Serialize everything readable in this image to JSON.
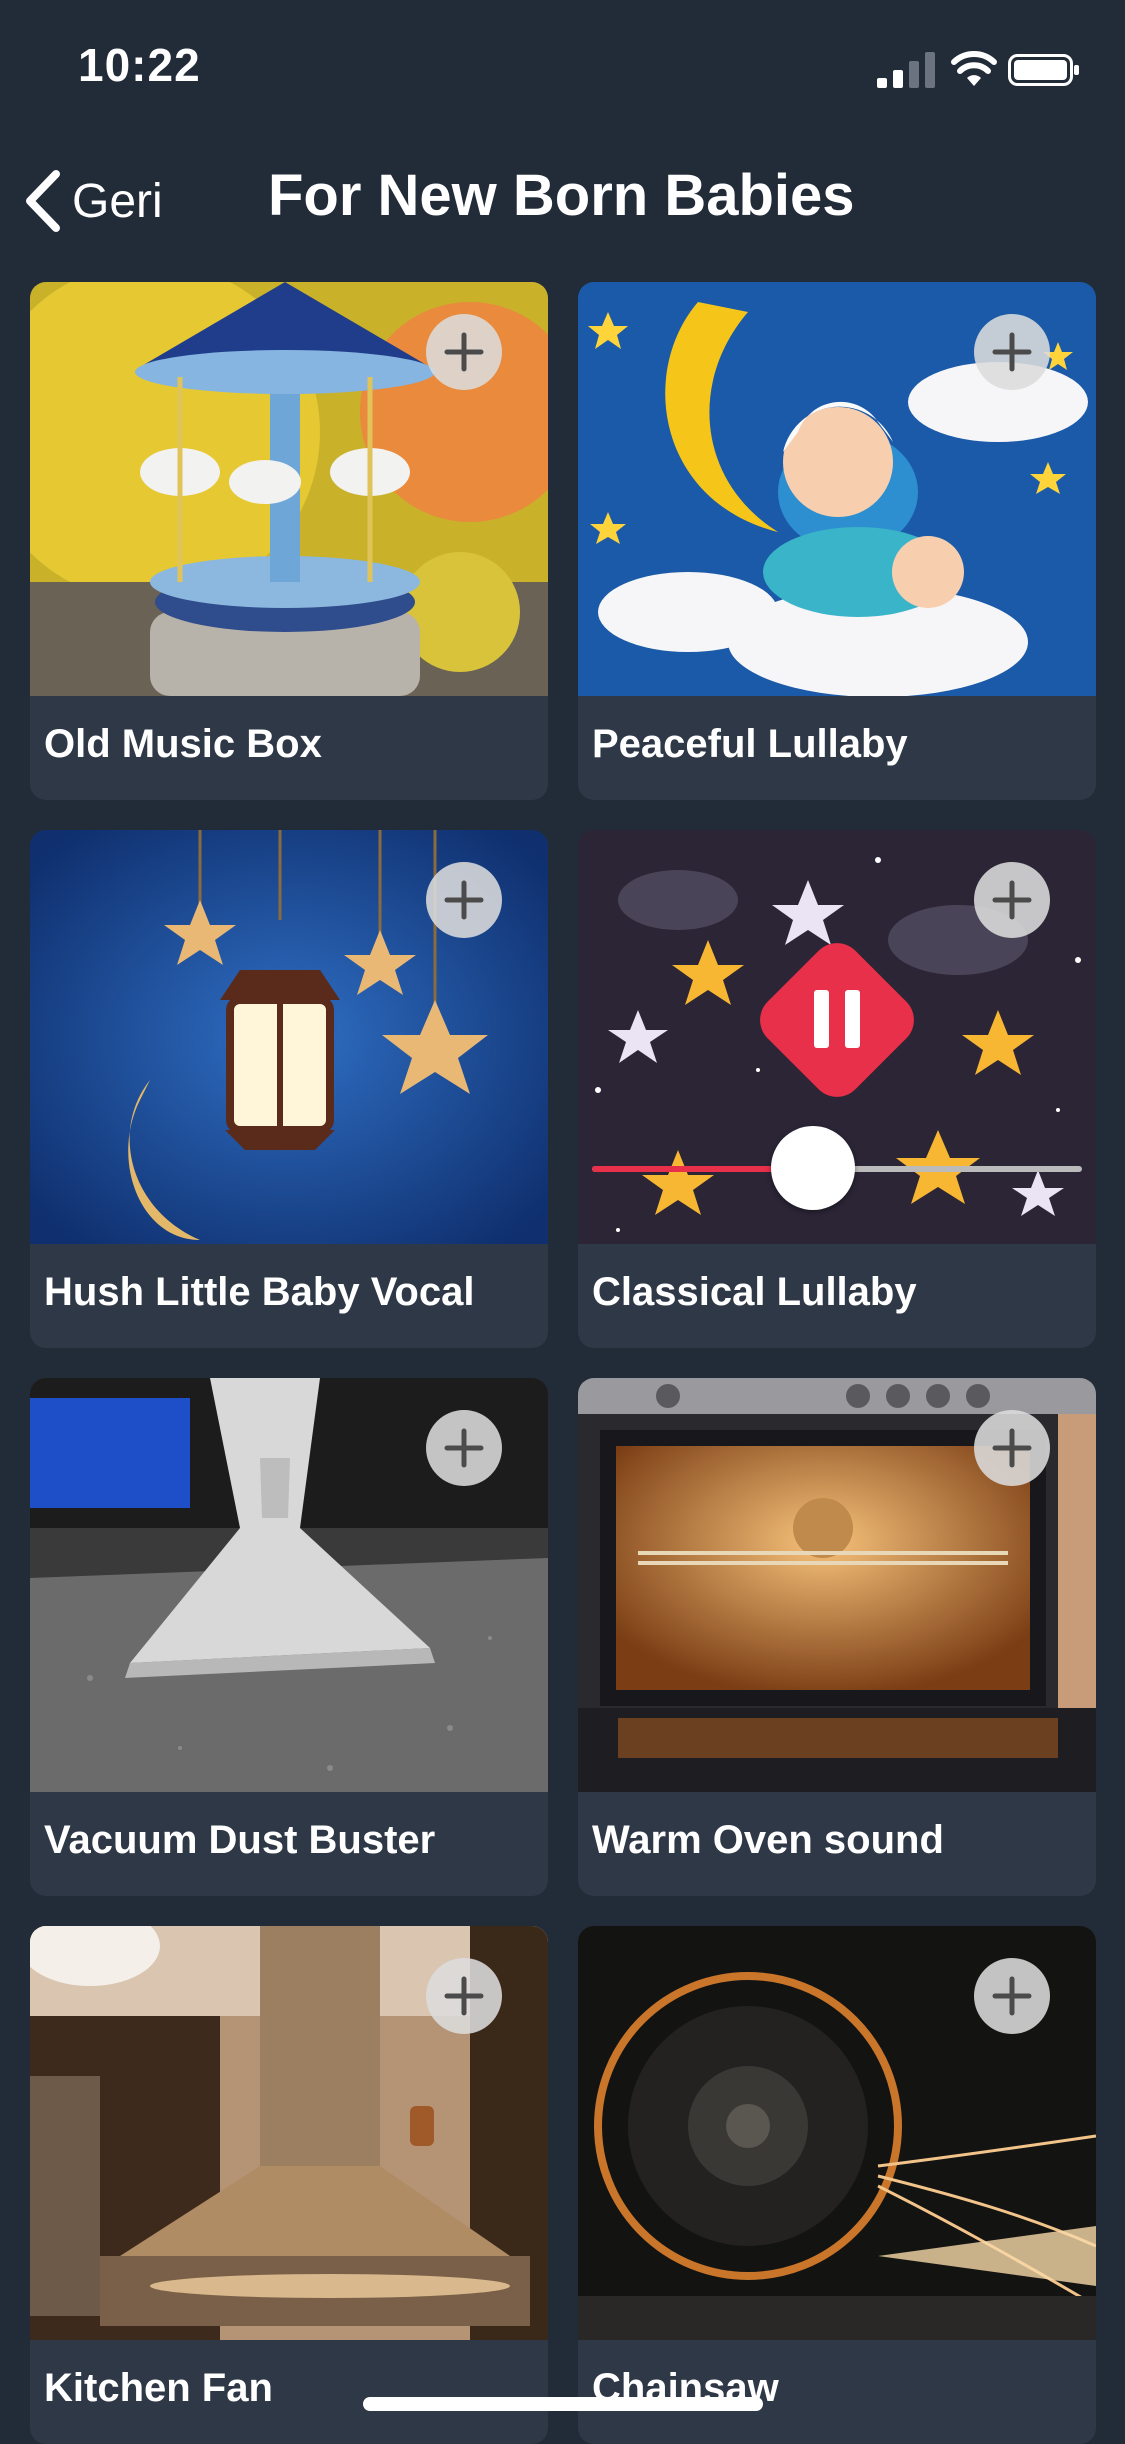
{
  "status_bar": {
    "time": "10:22"
  },
  "nav": {
    "back_label": "Geri",
    "title": "For New Born Babies"
  },
  "sounds": [
    {
      "title": "Old Music Box",
      "image": "music-box-carousel-image"
    },
    {
      "title": "Peaceful Lullaby",
      "image": "baby-on-moon-image"
    },
    {
      "title": "Hush Little Baby Vocal",
      "image": "hanging-lantern-stars-image"
    },
    {
      "title": "Classical Lullaby",
      "image": "dancing-stars-image",
      "playing": true,
      "progress": 0.45
    },
    {
      "title": "Vacuum Dust Buster",
      "image": "vacuum-nozzle-image"
    },
    {
      "title": "Warm Oven sound",
      "image": "oven-interior-image"
    },
    {
      "title": "Kitchen Fan",
      "image": "kitchen-hood-image"
    },
    {
      "title": "Chainsaw",
      "image": "spinning-sparks-image"
    }
  ],
  "colors": {
    "background": "#222b38",
    "card": "#2e3846",
    "accent": "#e8304a"
  }
}
